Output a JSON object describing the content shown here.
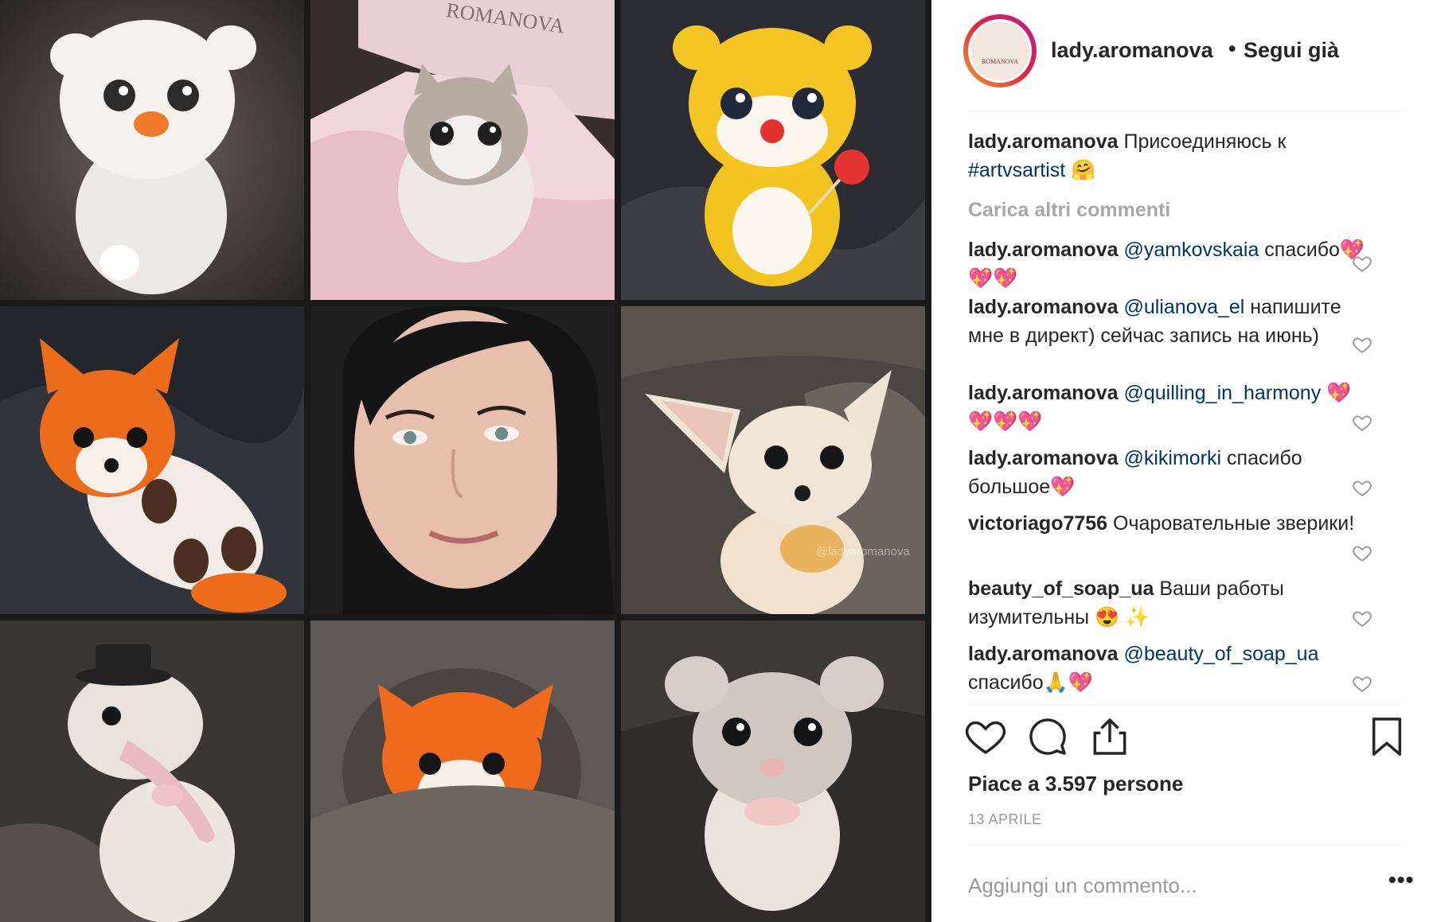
{
  "post": {
    "photos": [
      {
        "subject": "white felted fluffy creature with orange nose"
      },
      {
        "subject": "felted kitten in pink tissue gift box",
        "box_text": "ROMANOVA"
      },
      {
        "subject": "yellow felted bear cub holding red lollipop"
      },
      {
        "subject": "orange felted fox cub lying on back"
      },
      {
        "subject": "portrait of dark-haired woman"
      },
      {
        "subject": "cream felted fennec fox with big ears",
        "watermark": "@ladyaromanova"
      },
      {
        "subject": "felted opossum with top hat"
      },
      {
        "subject": "orange felted fox in knitted pocket"
      },
      {
        "subject": "grey felted mouse"
      }
    ],
    "colors": {
      "link": "#003569",
      "muted": "#999999",
      "text": "#262626"
    }
  },
  "header": {
    "username": "lady.aromanova",
    "separator": "•",
    "follow_status": "Segui già",
    "avatar_brand": "ROMANOVA"
  },
  "caption": {
    "user": "lady.aromanova",
    "text": "Присоединяюсь к",
    "hashtag": "#artvsartist",
    "emoji": "🤗"
  },
  "load_more": "Carica altri commenti",
  "comments": [
    {
      "user": "lady.aromanova",
      "mention": "@yamkovskaia",
      "text": "спасибо💖💖💖"
    },
    {
      "user": "lady.aromanova",
      "mention": "@ulianova_el",
      "text": "напишите мне в директ) сейчас запись на июнь)"
    },
    {
      "user": "lady.aromanova",
      "mention": "@quilling_in_harmony",
      "text": "💖💖💖💖"
    },
    {
      "user": "lady.aromanova",
      "mention": "@kikimorki",
      "text": "спасибо большое💖"
    },
    {
      "user": "victoriago7756",
      "mention": "",
      "text": "Очаровательные зверики!"
    },
    {
      "user": "beauty_of_soap_ua",
      "mention": "",
      "text": "Ваши работы изумительны 😍 ✨"
    },
    {
      "user": "lady.aromanova",
      "mention": "@beauty_of_soap_ua",
      "text": "спасибо🙏💖"
    }
  ],
  "actions": {
    "like": "heart-icon",
    "comment": "comment-icon",
    "share": "share-icon",
    "save": "bookmark-icon"
  },
  "likes_text": "Piace a 3.597 persone",
  "date": "13 APRILE",
  "add_comment_placeholder": "Aggiungi un commento...",
  "more_options": "•••"
}
